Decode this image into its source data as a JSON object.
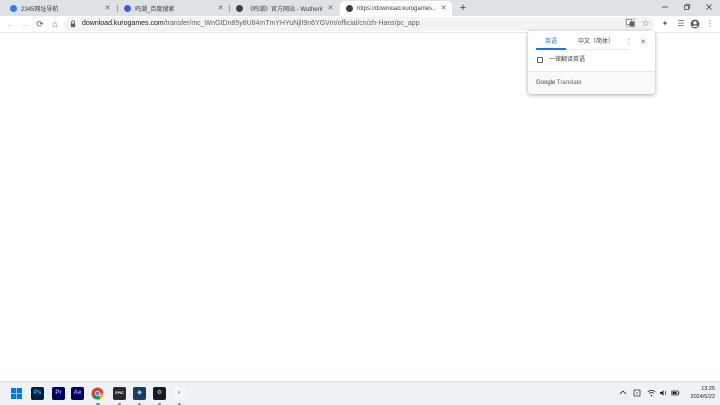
{
  "tabs": [
    {
      "title": "2345网址导航"
    },
    {
      "title": "鸣潮_百度搜索"
    },
    {
      "title": "《鸣潮》官方网站 - Wuthering..."
    },
    {
      "title": "https://download.kurogames..."
    }
  ],
  "omnibox": {
    "host": "download.kurogames.com",
    "path": "/transfer/mc_WnGtDn85y8U84mTmYHYuNjlI9n6YGVm/official/cn/zh-Hans/pc_app"
  },
  "translate_popup": {
    "source_tab": "英语",
    "target_tab": "中文（简体）",
    "checkbox_label": "一律翻译英语",
    "brand_google": "Google",
    "brand_translate": "Translate"
  },
  "icons": {
    "new_tab": "+",
    "back": "←",
    "forward": "→",
    "reload": "⟳",
    "home": "⌂",
    "star": "☆",
    "extensions": "✦",
    "reading_list": "☰",
    "more": "⋮",
    "close": "✕"
  },
  "colors": {
    "accent": "#1a73e8",
    "tabstrip": "#dee1e6",
    "omnibox": "#f1f3f4",
    "taskbar": "#eef1f6"
  },
  "taskbar": {
    "apps": [
      {
        "name": "windows-start",
        "glyph": "",
        "bg": "#0078d4",
        "fg": "#ffffff"
      },
      {
        "name": "photoshop",
        "glyph": "Ps",
        "bg": "#001e36",
        "fg": "#31a8ff"
      },
      {
        "name": "premiere",
        "glyph": "Pr",
        "bg": "#00005b",
        "fg": "#9999ff"
      },
      {
        "name": "after-effects",
        "glyph": "Ae",
        "bg": "#00005b",
        "fg": "#9999ff"
      },
      {
        "name": "chrome",
        "glyph": "",
        "bg": "#ffffff",
        "fg": "#ffffff"
      },
      {
        "name": "epic-games",
        "glyph": "EPIC",
        "bg": "#2a2a2a",
        "fg": "#ffffff"
      },
      {
        "name": "cube-app",
        "glyph": "◆",
        "bg": "#1e3a5f",
        "fg": "#7fd3ff"
      },
      {
        "name": "steam",
        "glyph": "⚙",
        "bg": "#171a21",
        "fg": "#c7d5e0"
      },
      {
        "name": "game-launcher",
        "glyph": "◐",
        "bg": "#f5f5f5",
        "fg": "#2aa876"
      }
    ],
    "clock_time": "13:25",
    "clock_date": "2024/5/22"
  }
}
